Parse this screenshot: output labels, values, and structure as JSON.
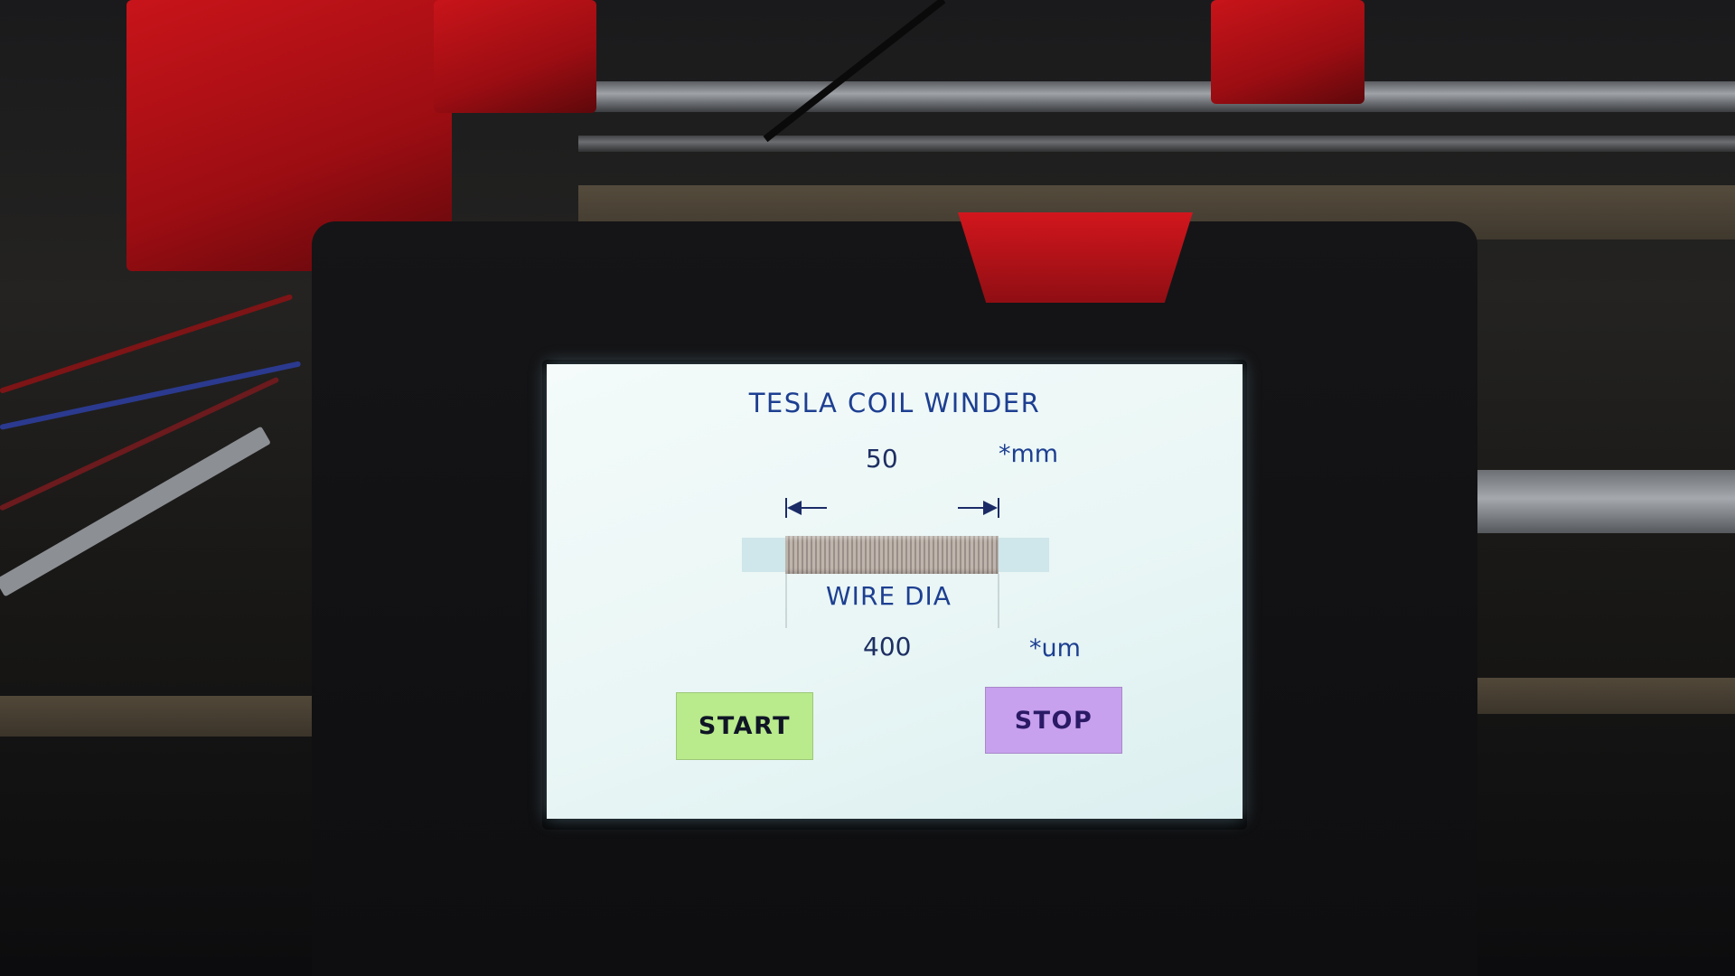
{
  "app": {
    "title": "TESLA COIL WINDER"
  },
  "coil_length": {
    "value": "50",
    "unit": "*mm"
  },
  "wire_diameter": {
    "label": "WIRE DIA",
    "value": "400",
    "unit": "*um"
  },
  "controls": {
    "start_label": "START",
    "stop_label": "STOP"
  },
  "colors": {
    "screen_background": "#eaf6f5",
    "text": "#1d3f91",
    "start_button": "#b9ea8c",
    "stop_button": "#c7a0ee",
    "enclosure": "#111113",
    "bracket_red": "#c8141a"
  },
  "icons": {
    "left_arrow": "left-arrow-icon",
    "right_arrow": "right-arrow-icon"
  }
}
